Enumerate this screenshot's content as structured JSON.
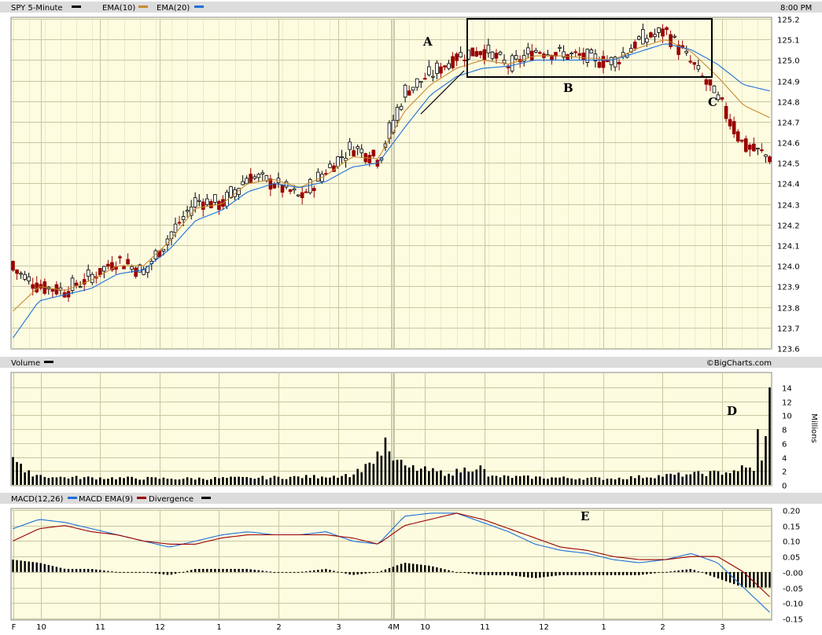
{
  "header": {
    "title": "SPY 5-Minute",
    "ema10_label": "EMA(10)",
    "ema20_label": "EMA(20)",
    "time": "8:00 PM"
  },
  "volume_panel": {
    "title": "Volume",
    "credit": "©BigCharts.com",
    "unit": "Millions"
  },
  "macd_panel": {
    "title": "MACD(12,26)",
    "signal_label": "MACD EMA(9)",
    "div_label": "Divergence"
  },
  "x_labels": [
    "F",
    "10",
    "11",
    "12",
    "1",
    "2",
    "3",
    "4M",
    "10",
    "11",
    "12",
    "1",
    "2",
    "3"
  ],
  "annotations": {
    "A": "A",
    "B": "B",
    "C": "C",
    "D": "D",
    "E": "E"
  },
  "colors": {
    "background": "#fdfce1",
    "up": "#ffffff",
    "down": "#990000",
    "ema10": "#c88a30",
    "ema20": "#1e6fd9",
    "macd_ema": "#990000"
  },
  "chart_data": [
    {
      "type": "candlestick",
      "title": "SPY 5-Minute",
      "ylim": [
        123.6,
        125.2
      ],
      "y_ticks": [
        "125.2",
        "125.1",
        "125.0",
        "124.9",
        "124.8",
        "124.7",
        "124.6",
        "124.5",
        "124.4",
        "124.3",
        "124.2",
        "124.1",
        "124.0",
        "123.9",
        "123.8",
        "123.7",
        "123.6"
      ],
      "close_keypoints": [
        123.98,
        123.9,
        123.88,
        123.95,
        124.03,
        123.97,
        124.15,
        124.32,
        124.3,
        124.44,
        124.4,
        124.33,
        124.47,
        124.58,
        124.52,
        124.85,
        124.93,
        125.02,
        125.05,
        124.97,
        125.05,
        125.03,
        125.01,
        124.99,
        125.1,
        125.14,
        124.98,
        124.81,
        124.58,
        124.53
      ],
      "series": [
        {
          "name": "EMA(10)",
          "values": [
            123.78,
            123.9,
            123.88,
            123.93,
            124.0,
            124.0,
            124.12,
            124.28,
            124.3,
            124.4,
            124.42,
            124.38,
            124.44,
            124.53,
            124.52,
            124.75,
            124.88,
            124.96,
            125.0,
            124.98,
            125.02,
            125.02,
            125.01,
            125.0,
            125.06,
            125.1,
            125.04,
            124.92,
            124.78,
            124.72
          ]
        },
        {
          "name": "EMA(20)",
          "values": [
            123.65,
            123.83,
            123.86,
            123.89,
            123.96,
            123.98,
            124.08,
            124.22,
            124.27,
            124.36,
            124.4,
            124.38,
            124.41,
            124.48,
            124.5,
            124.67,
            124.83,
            124.92,
            124.96,
            124.97,
            125.0,
            125.0,
            125.0,
            125.0,
            125.04,
            125.08,
            125.05,
            124.98,
            124.88,
            124.85
          ]
        }
      ]
    },
    {
      "type": "bar",
      "title": "Volume",
      "ylabel": "Millions",
      "ylim": [
        0,
        14
      ],
      "y_ticks": [
        "14",
        "12",
        "10",
        "8",
        "6",
        "4",
        "2",
        "0"
      ],
      "keypoints": [
        {
          "i": 0,
          "v": 4
        },
        {
          "i": 3,
          "v": 1.8
        },
        {
          "i": 10,
          "v": 1.1
        },
        {
          "i": 40,
          "v": 0.9
        },
        {
          "i": 60,
          "v": 1.0
        },
        {
          "i": 78,
          "v": 1.2
        },
        {
          "i": 86,
          "v": 1.5
        },
        {
          "i": 90,
          "v": 3.2
        },
        {
          "i": 93,
          "v": 4.2
        },
        {
          "i": 94,
          "v": 6.8
        },
        {
          "i": 96,
          "v": 3.5
        },
        {
          "i": 100,
          "v": 2.5
        },
        {
          "i": 110,
          "v": 1.6
        },
        {
          "i": 118,
          "v": 2.8
        },
        {
          "i": 120,
          "v": 1.2
        },
        {
          "i": 150,
          "v": 0.9
        },
        {
          "i": 170,
          "v": 1.5
        },
        {
          "i": 180,
          "v": 1.8
        },
        {
          "i": 185,
          "v": 2.5
        },
        {
          "i": 187,
          "v": 2.0
        },
        {
          "i": 188,
          "v": 8.0
        },
        {
          "i": 189,
          "v": 3.5
        },
        {
          "i": 190,
          "v": 7.0
        },
        {
          "i": 191,
          "v": 14.0
        }
      ]
    },
    {
      "type": "line",
      "title": "MACD(12,26)",
      "ylim": [
        -0.15,
        0.2
      ],
      "y_ticks": [
        "0.20",
        "0.15",
        "0.10",
        "0.05",
        "-0.00",
        "-0.05",
        "-0.10",
        "-0.15"
      ],
      "series": [
        {
          "name": "MACD(12,26)",
          "values": [
            0.14,
            0.17,
            0.16,
            0.14,
            0.12,
            0.1,
            0.08,
            0.1,
            0.12,
            0.13,
            0.12,
            0.12,
            0.13,
            0.1,
            0.09,
            0.18,
            0.19,
            0.19,
            0.16,
            0.13,
            0.09,
            0.07,
            0.06,
            0.04,
            0.03,
            0.04,
            0.06,
            0.03,
            -0.05,
            -0.13
          ]
        },
        {
          "name": "MACD EMA(9)",
          "values": [
            0.1,
            0.14,
            0.15,
            0.13,
            0.12,
            0.1,
            0.09,
            0.09,
            0.11,
            0.12,
            0.12,
            0.12,
            0.12,
            0.11,
            0.09,
            0.15,
            0.17,
            0.19,
            0.17,
            0.14,
            0.11,
            0.08,
            0.07,
            0.05,
            0.04,
            0.04,
            0.05,
            0.05,
            0.0,
            -0.08
          ]
        },
        {
          "name": "Divergence",
          "values": [
            0.04,
            0.03,
            0.01,
            0.01,
            0.0,
            0.0,
            -0.01,
            0.01,
            0.01,
            0.01,
            0.0,
            0.0,
            0.01,
            -0.01,
            0.0,
            0.03,
            0.02,
            0.0,
            -0.01,
            -0.01,
            -0.02,
            -0.01,
            -0.01,
            -0.01,
            -0.01,
            0.0,
            0.01,
            -0.02,
            -0.05,
            -0.05
          ]
        }
      ]
    }
  ]
}
